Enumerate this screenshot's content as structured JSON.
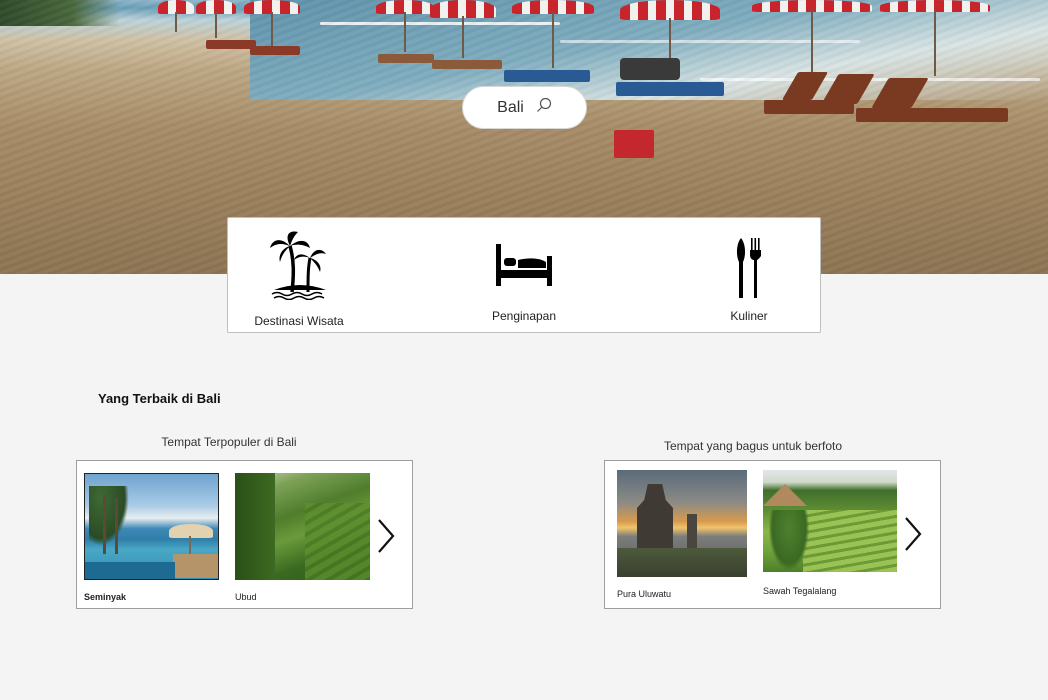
{
  "search": {
    "value": "Bali",
    "icon": "search-icon"
  },
  "categories": [
    {
      "label": "Destinasi Wisata",
      "icon": "palm-tree-island-icon"
    },
    {
      "label": "Penginapan",
      "icon": "bed-icon"
    },
    {
      "label": "Kuliner",
      "icon": "fork-knife-icon"
    }
  ],
  "section": {
    "title": "Yang Terbaik di Bali"
  },
  "carousels": [
    {
      "title": "Tempat Terpopuler di Bali",
      "items": [
        {
          "caption": "Seminyak",
          "image": "infinity-pool-beach-photo"
        },
        {
          "caption": "Ubud",
          "image": "rice-terrace-jungle-photo"
        }
      ],
      "next_icon": "chevron-right-icon"
    },
    {
      "title": "Tempat yang bagus untuk berfoto",
      "items": [
        {
          "caption": "Pura Uluwatu",
          "image": "temple-sunset-photo"
        },
        {
          "caption": "Sawah Tegalalang",
          "image": "rice-terrace-photo"
        }
      ],
      "next_icon": "chevron-right-icon"
    }
  ],
  "colors": {
    "page_bg": "#f4f4f4",
    "card_border": "#bfbfbf",
    "umbrella_red": "#c8242b",
    "lounger_blue": "#2a5a93",
    "lounger_brown": "#7a3a22"
  }
}
